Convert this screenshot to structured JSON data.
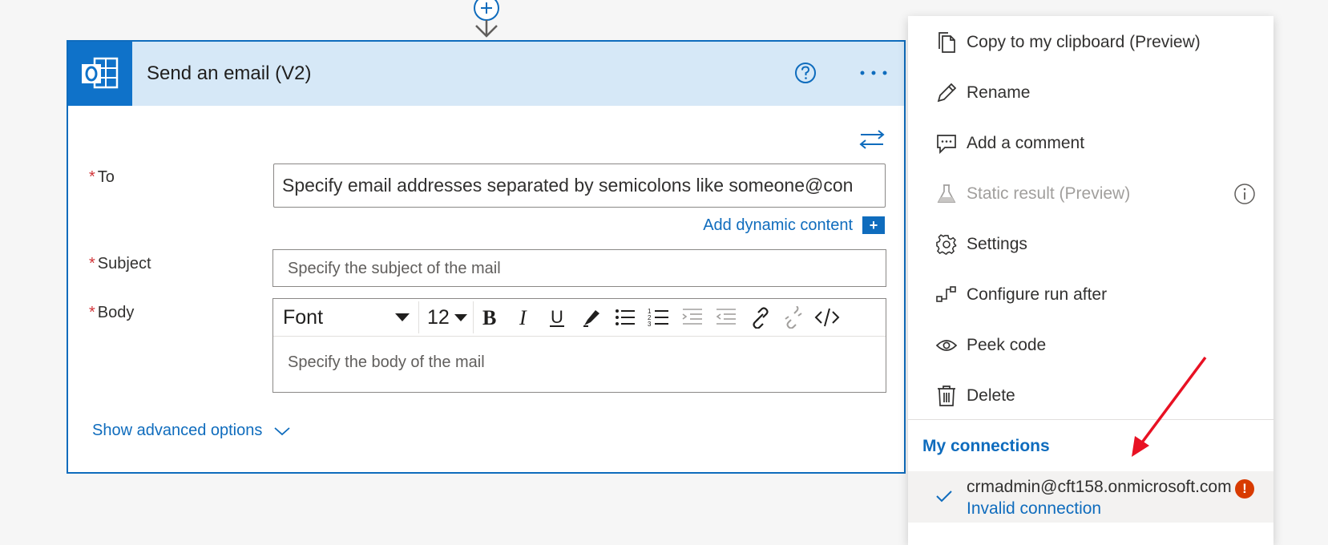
{
  "step": {
    "title": "Send an email (V2)",
    "app_icon": "outlook-icon",
    "accent_color": "#0f6cbd",
    "header_color": "#d6e8f7"
  },
  "fields": {
    "to": {
      "label": "To",
      "required_mark": "*",
      "placeholder": "Specify email addresses separated by semicolons like someone@con"
    },
    "dynamic_content_label": "Add dynamic content",
    "dynamic_content_button": "+",
    "subject": {
      "label": "Subject",
      "required_mark": "*",
      "placeholder": "Specify the subject of the mail"
    },
    "body": {
      "label": "Body",
      "required_mark": "*",
      "font": "Font",
      "font_size": "12",
      "placeholder": "Specify the body of the mail"
    }
  },
  "advanced_options_label": "Show advanced options",
  "menu": {
    "items": [
      {
        "label": "Copy to my clipboard (Preview)",
        "icon": "clipboard-icon",
        "enabled": true
      },
      {
        "label": "Rename",
        "icon": "pencil-icon",
        "enabled": true
      },
      {
        "label": "Add a comment",
        "icon": "comment-icon",
        "enabled": true
      },
      {
        "label": "Static result (Preview)",
        "icon": "flask-icon",
        "enabled": false
      },
      {
        "label": "Settings",
        "icon": "gear-icon",
        "enabled": true
      },
      {
        "label": "Configure run after",
        "icon": "run-after-icon",
        "enabled": true
      },
      {
        "label": "Peek code",
        "icon": "eye-icon",
        "enabled": true
      },
      {
        "label": "Delete",
        "icon": "trash-icon",
        "enabled": true
      }
    ],
    "section_title": "My connections",
    "connection": {
      "account": "crmadmin@cft158.onmicrosoft.com",
      "status": "Invalid connection",
      "warning": "!"
    }
  }
}
